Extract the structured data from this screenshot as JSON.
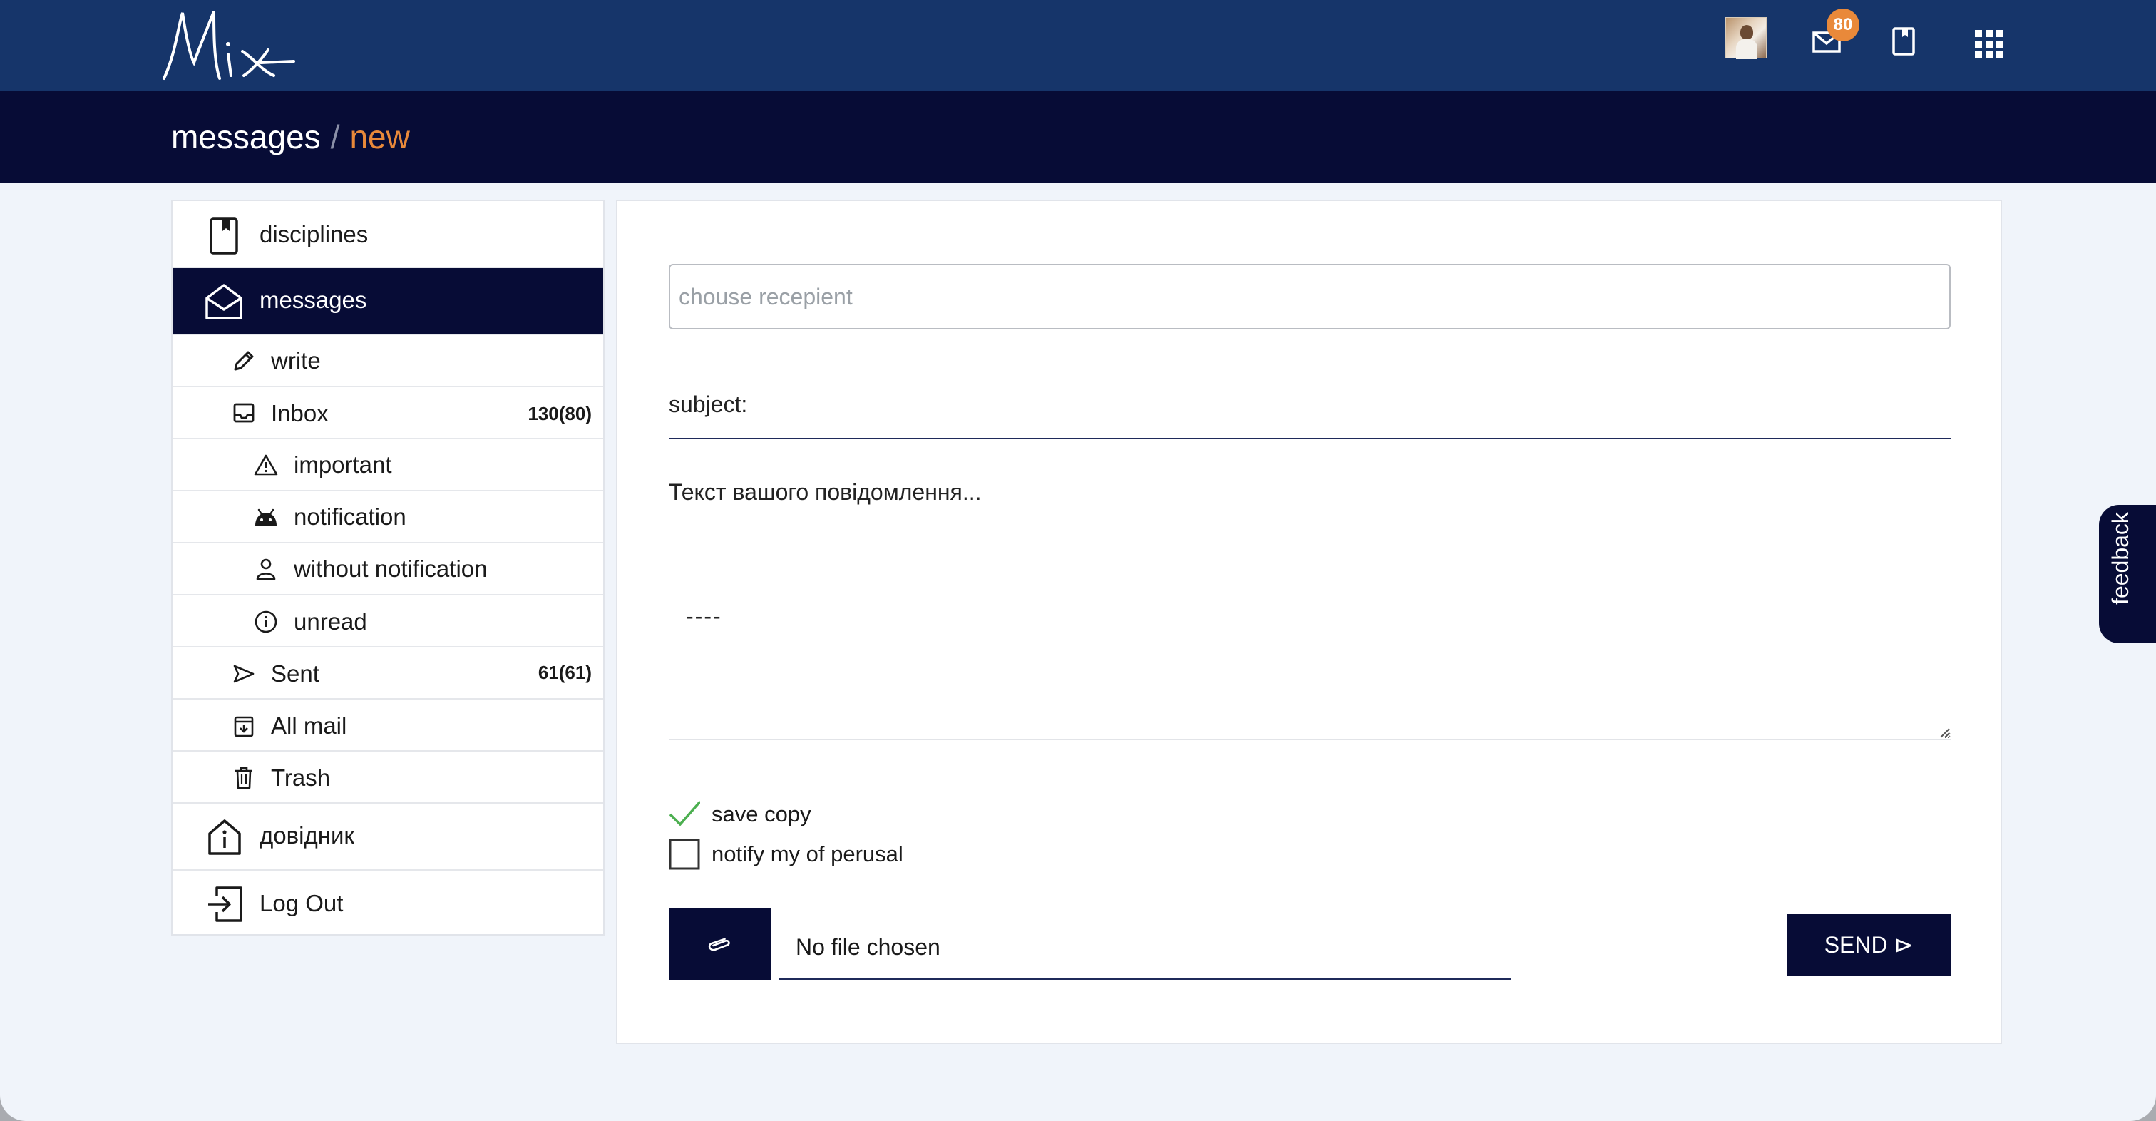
{
  "header": {
    "logo_text": "Mix",
    "mail_badge_count": "80"
  },
  "breadcrumb": {
    "section": "messages",
    "separator": "/",
    "current": "new"
  },
  "sidebar": {
    "items": [
      {
        "label": "disciplines",
        "icon": "book-icon"
      },
      {
        "label": "messages",
        "icon": "envelope-open-icon",
        "active": true
      },
      {
        "label": "write",
        "icon": "pencil-icon"
      },
      {
        "label": "Inbox",
        "icon": "inbox-icon",
        "count": "130(80)"
      },
      {
        "label": "important",
        "icon": "warning-triangle-icon"
      },
      {
        "label": "notification",
        "icon": "android-icon"
      },
      {
        "label": "without notification",
        "icon": "person-icon"
      },
      {
        "label": "unread",
        "icon": "info-circle-icon"
      },
      {
        "label": "Sent",
        "icon": "send-arrow-icon",
        "count": "61(61)"
      },
      {
        "label": "All mail",
        "icon": "archive-icon"
      },
      {
        "label": "Trash",
        "icon": "trash-icon"
      },
      {
        "label": "довідник",
        "icon": "info-house-icon"
      },
      {
        "label": "Log Out",
        "icon": "logout-icon"
      }
    ]
  },
  "compose": {
    "recipient_placeholder": "chouse recepient",
    "subject_placeholder": "subject:",
    "message_placeholder": "Текст вашого повідомлення...",
    "signature": "----",
    "save_copy_label": "save copy",
    "save_copy_checked": true,
    "notify_label": "notify my of perusal",
    "notify_checked": false,
    "file_status": "No file chosen",
    "send_label": "SEND ⊳"
  },
  "feedback": {
    "label": "feedback"
  },
  "colors": {
    "header_bg": "#16356a",
    "breadcrumb_bg": "#070c36",
    "accent": "#e9893a",
    "check_green": "#4caf50"
  }
}
